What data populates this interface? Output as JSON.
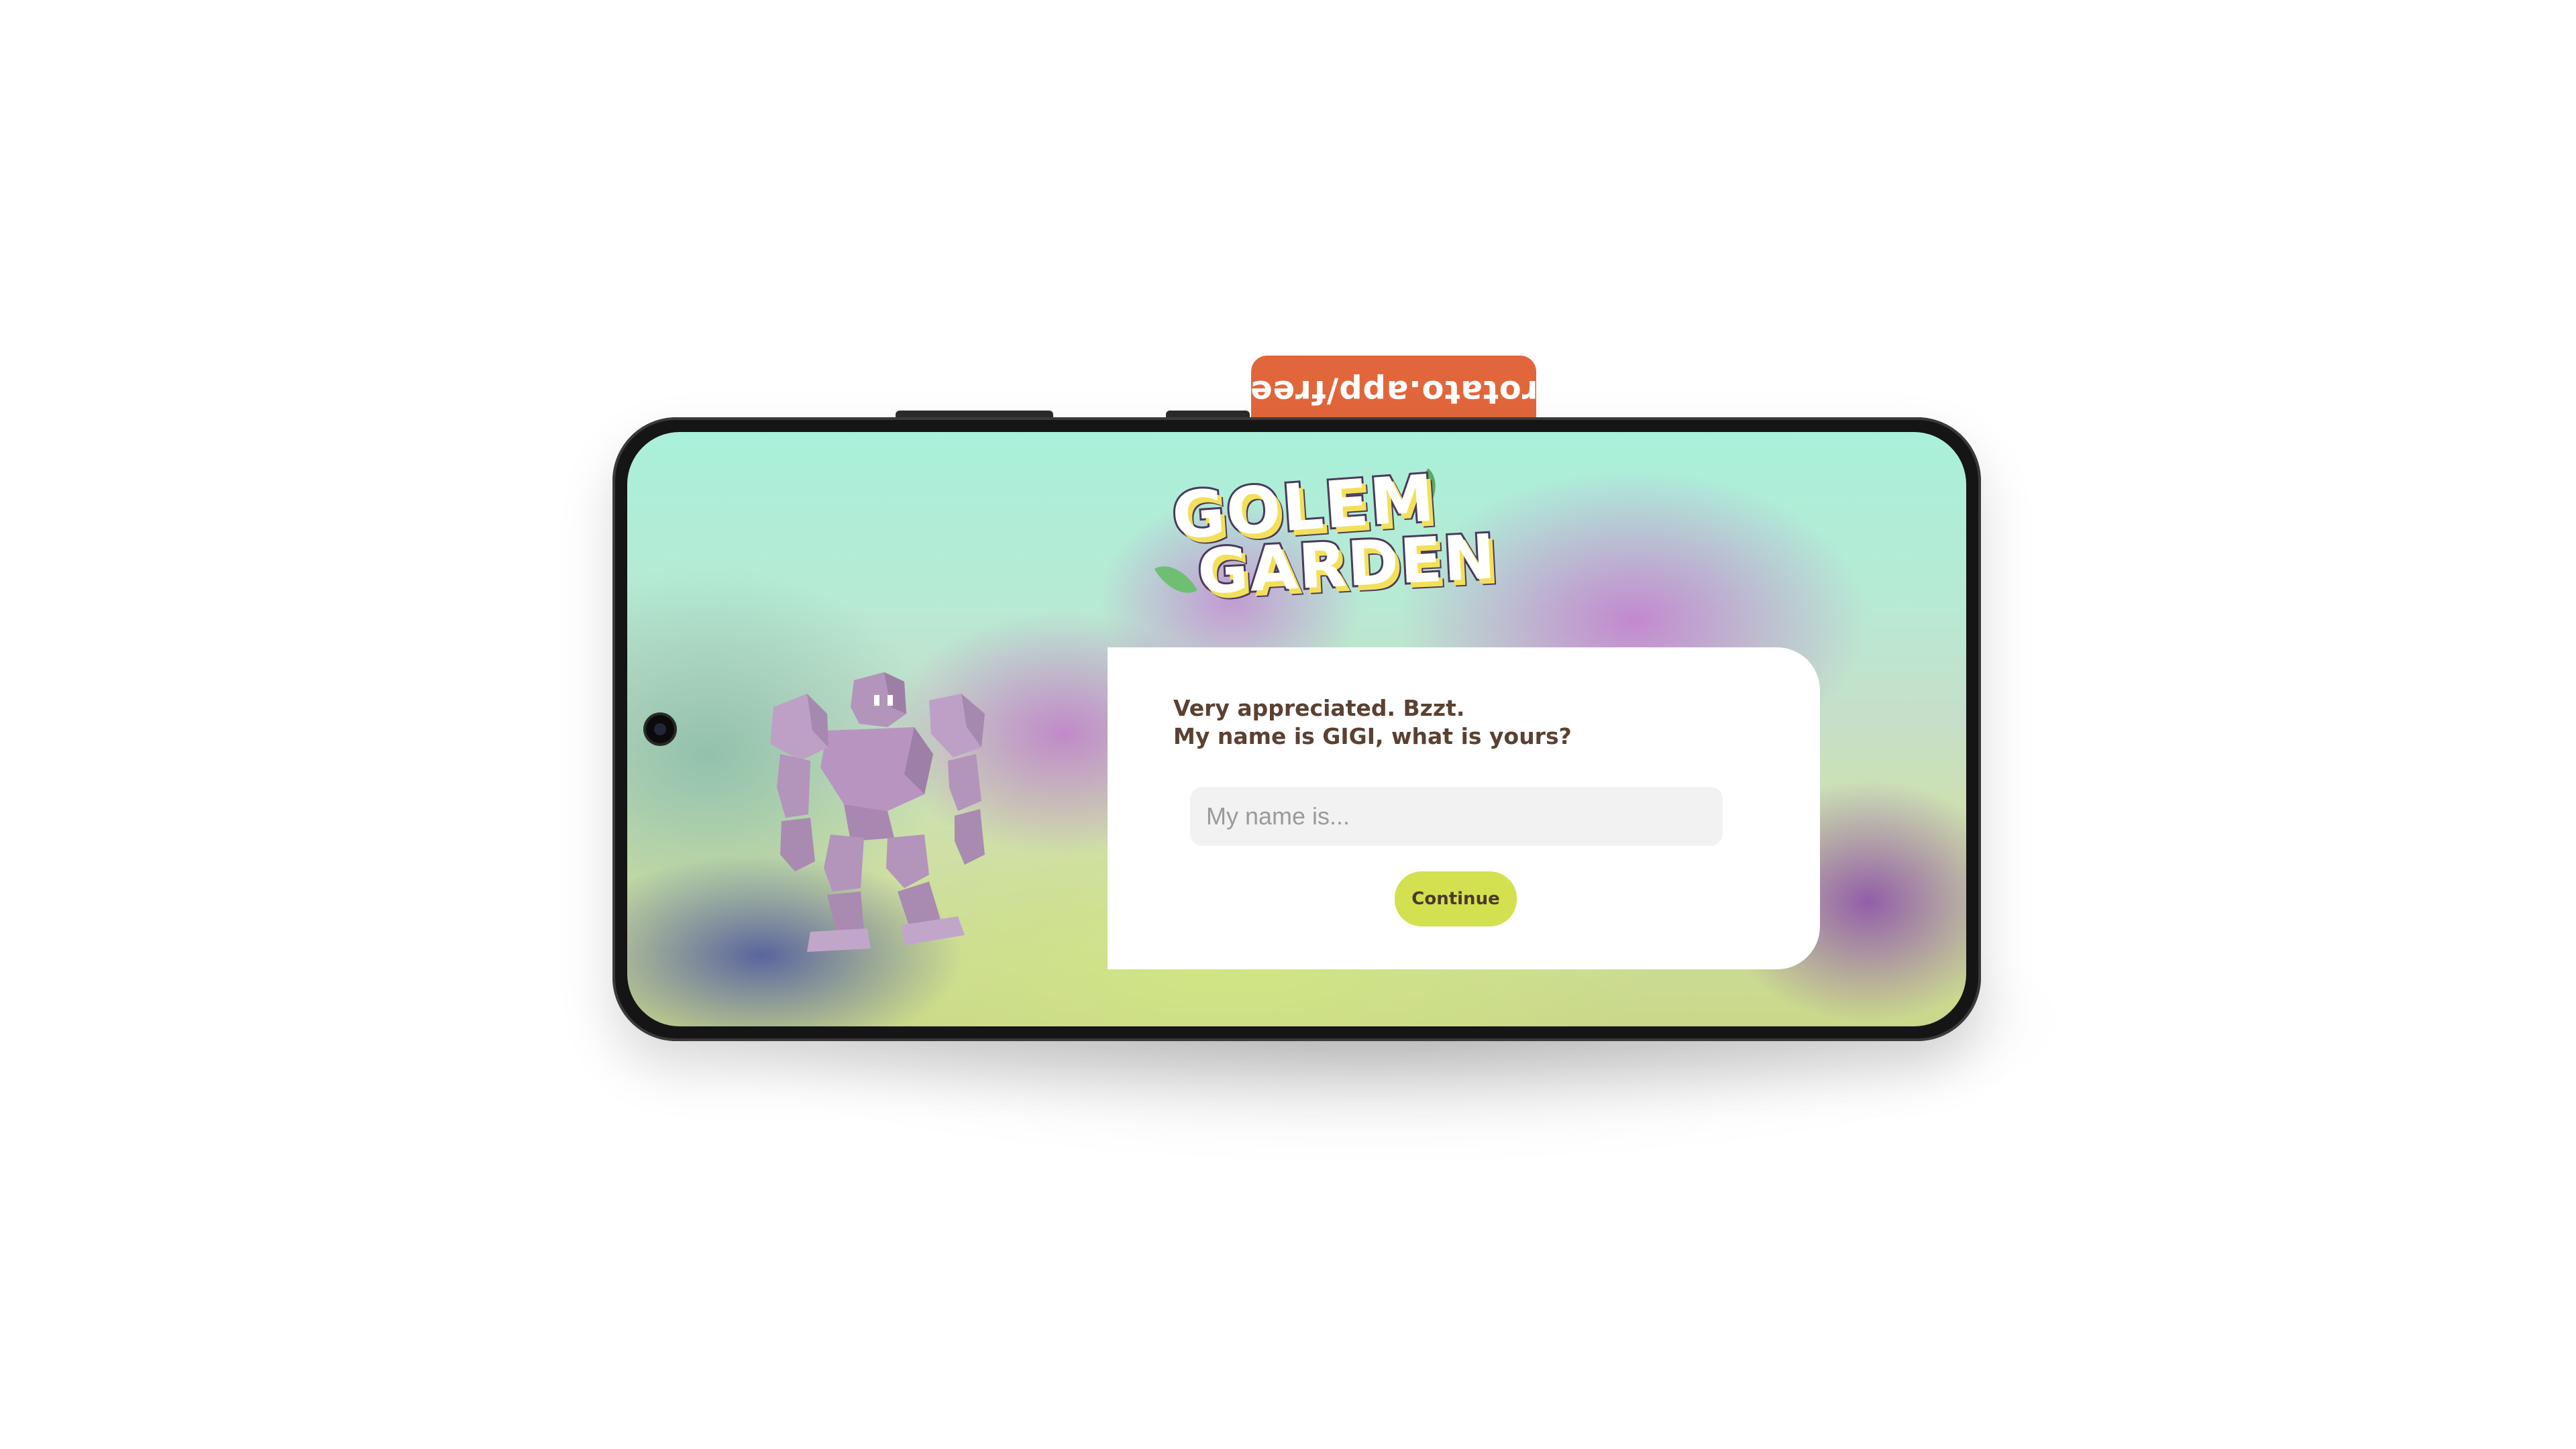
{
  "watermark": {
    "text": "rotato.app/free",
    "color": "#e2663b"
  },
  "game": {
    "logo_line1": "GOLEM",
    "logo_line2": "GARDEN",
    "character_icon": "golem-icon"
  },
  "dialog": {
    "line1": "Very appreciated. Bzzt.",
    "line2": "My name is GIGI, what is yours?",
    "input_value": "",
    "input_placeholder": "My name is...",
    "continue_label": "Continue",
    "button_color": "#d3e04f",
    "text_color": "#5a4131"
  }
}
